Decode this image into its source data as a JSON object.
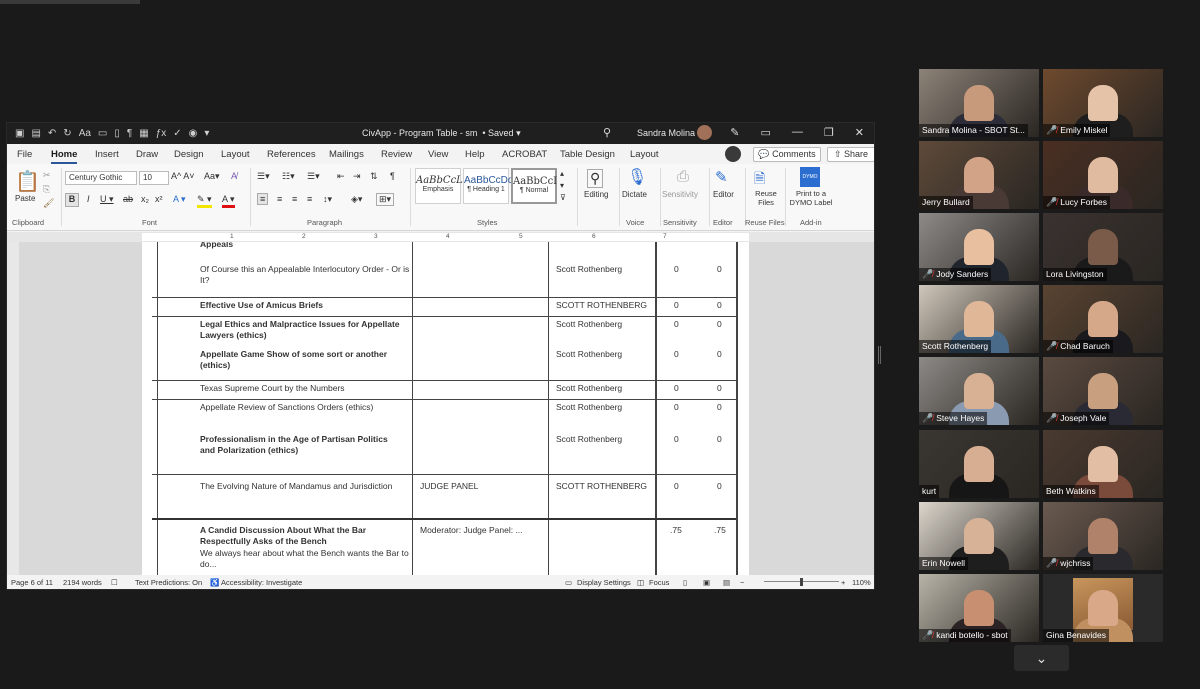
{
  "word": {
    "qat_icons": [
      "autosave-icon",
      "save-icon",
      "undo-icon",
      "redo-icon",
      "font-size-icon",
      "new-doc-icon",
      "print-preview-icon",
      "pilcrow-icon",
      "table-icon",
      "equation-icon",
      "spelling-icon",
      "circle-icon",
      "customize-icon"
    ],
    "doc_title": "CivApp - Program Table - sm",
    "saved": "• Saved",
    "user": "Sandra Molina",
    "tabs": [
      "File",
      "Home",
      "Insert",
      "Draw",
      "Design",
      "Layout",
      "References",
      "Mailings",
      "Review",
      "View",
      "Help",
      "ACROBAT",
      "Table Design",
      "Layout"
    ],
    "active_tab": "Home",
    "comments": "Comments",
    "share": "Share",
    "ribbon": {
      "paste": "Paste",
      "clipboard": "Clipboard",
      "font_name": "Century Gothic",
      "font_size": "10",
      "font": "Font",
      "paragraph": "Paragraph",
      "styles_label": "Styles",
      "styles": [
        {
          "sample": "AaBbCcL",
          "name": "Emphasis"
        },
        {
          "sample": "AaBbCcDdI",
          "name": "¶ Heading 1"
        },
        {
          "sample": "AaBbCcI",
          "name": "¶ Normal"
        }
      ],
      "editing": "Editing",
      "dictate": "Dictate",
      "voice": "Voice",
      "sensitivity": "Sensitivity",
      "sensitivity_group": "Sensitivity",
      "editor": "Editor",
      "editor_group": "Editor",
      "reuse_files": "Reuse Files",
      "reuse_group": "Reuse Files",
      "dymo": "Print to a DYMO Label",
      "addin": "Add-in"
    },
    "ruler_numbers": [
      "1",
      "2",
      "3",
      "4",
      "5",
      "6",
      "7"
    ],
    "table_rows": [
      {
        "title": "Appeals",
        "speaker": "",
        "a": "",
        "b": ""
      },
      {
        "title": "Of Course this an Appealable Interlocutory Order - Or is It?",
        "speaker": "Scott Rothenberg",
        "a": "0",
        "b": "0"
      },
      {
        "title": "Effective Use of Amicus Briefs",
        "speaker": "SCOTT ROTHENBERG",
        "a": "0",
        "b": "0"
      },
      {
        "title": "Legal Ethics and Malpractice Issues for Appellate Lawyers (ethics)",
        "speaker": "Scott Rothenberg",
        "a": "0",
        "b": "0"
      },
      {
        "title": "Appellate Game Show of some sort or another (ethics)",
        "speaker": "Scott Rothenberg",
        "a": "0",
        "b": "0"
      },
      {
        "title": "Texas Supreme Court by the Numbers",
        "speaker": "Scott Rothenberg",
        "a": "0",
        "b": "0"
      },
      {
        "title": "Appellate Review of Sanctions Orders (ethics)",
        "speaker": "Scott Rothenberg",
        "a": "0",
        "b": "0"
      },
      {
        "title": "Professionalism in the Age of Partisan Politics and Polarization (ethics)",
        "speaker": "Scott Rothenberg",
        "a": "0",
        "b": "0"
      },
      {
        "title": "The Evolving Nature of Mandamus and Jurisdiction",
        "speaker2": "JUDGE PANEL",
        "speaker": "SCOTT ROTHENBERG",
        "a": "0",
        "b": "0"
      },
      {
        "title": "A Candid Discussion About What the Bar Respectfully Asks of the Bench",
        "sub": "We always hear about what the Bench wants the Bar to do...",
        "speaker2": "Moderator: Judge Panel: ...",
        "speaker": "",
        "a": ".75",
        "b": ".75"
      }
    ],
    "status": {
      "page": "Page 6 of 11",
      "words": "2194 words",
      "predictions": "Text Predictions: On",
      "accessibility": "Accessibility: Investigate",
      "display": "Display Settings",
      "focus": "Focus",
      "zoom": "110%"
    }
  },
  "participants": [
    {
      "name": "Sandra Molina - SBOT St...",
      "muted": false,
      "skin": "#c79a7c",
      "bg": "#8c8278",
      "shirt": "#2d2d3a"
    },
    {
      "name": "Emily Miskel",
      "muted": true,
      "skin": "#e5c3a8",
      "bg": "#6e4a2e",
      "shirt": "#1e1e1e"
    },
    {
      "name": "Jerry Bullard",
      "muted": false,
      "skin": "#d2a386",
      "bg": "#5e4a3a",
      "shirt": "#4a3a36"
    },
    {
      "name": "Lucy Forbes",
      "muted": true,
      "skin": "#e0bba0",
      "bg": "#4a2f22",
      "shirt": "#3a2a2a"
    },
    {
      "name": "Jody Sanders",
      "muted": true,
      "skin": "#e8c0a0",
      "bg": "#8e8a88",
      "shirt": "#20242c"
    },
    {
      "name": "Lora Livingston",
      "muted": false,
      "skin": "#7a5a48",
      "bg": "#3a3230",
      "shirt": "#1a1a1a",
      "speaker": true
    },
    {
      "name": "Scott Rothenberg",
      "muted": false,
      "skin": "#e0b898",
      "bg": "#cfc7bb",
      "shirt": "#4a6a8a"
    },
    {
      "name": "Chad Baruch",
      "muted": true,
      "skin": "#d4a888",
      "bg": "#5a4432",
      "shirt": "#1a1a1e"
    },
    {
      "name": "Steve Hayes",
      "muted": true,
      "skin": "#d8b094",
      "bg": "#8c8a86",
      "shirt": "#8a9ab0"
    },
    {
      "name": "Joseph Vale",
      "muted": true,
      "skin": "#c8a080",
      "bg": "#5a4a40",
      "shirt": "#2a2a34"
    },
    {
      "name": "kurt",
      "muted": false,
      "skin": "#d8ae92",
      "bg": "#3a3632",
      "shirt": "#161616"
    },
    {
      "name": "Beth Watkins",
      "muted": false,
      "skin": "#e2bea4",
      "bg": "#4a3a30",
      "shirt": "#7a4a3a"
    },
    {
      "name": "Erin Nowell",
      "muted": false,
      "skin": "#d8b296",
      "bg": "#dcd6cc",
      "shirt": "#1e1e1e"
    },
    {
      "name": "wjchriss",
      "muted": true,
      "skin": "#b0826a",
      "bg": "#6a5a50",
      "shirt": "#2a2a2e"
    },
    {
      "name": "kandi botello - sbot",
      "muted": true,
      "skin": "#c89070",
      "bg": "#b8b4a8",
      "shirt": "#2a2224"
    },
    {
      "name": "Gina Benavides",
      "muted": false,
      "skin": "#d8a888",
      "bg": "#2a2a2a",
      "shirt": "#c09060",
      "photo": true
    }
  ]
}
